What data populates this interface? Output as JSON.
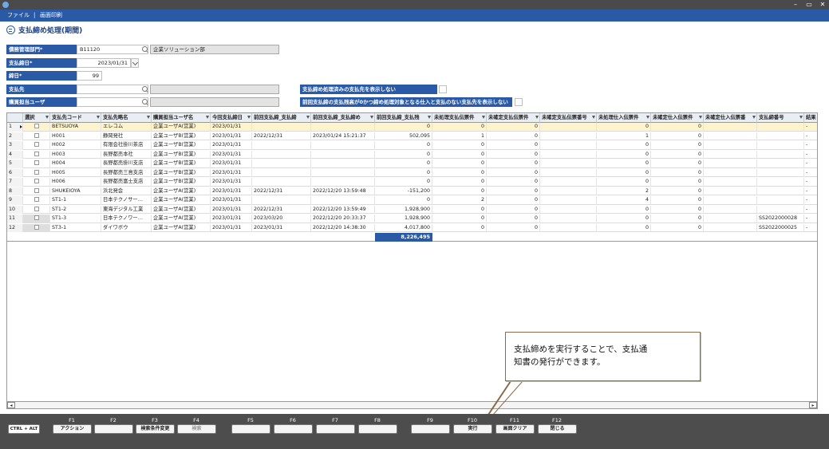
{
  "window": {
    "min": "–",
    "max": "▭",
    "close": "✕"
  },
  "menu": {
    "file": "ファイル",
    "sep": "|",
    "print": "画面印刷"
  },
  "page_title": "支払締め処理(期間)",
  "form": {
    "dept_label": "債務管理部門*",
    "dept_code": "B11120",
    "dept_name": "企業ソリューション部",
    "close_date_label": "支払締日*",
    "close_date": "2023/01/31",
    "close_day_label": "締日*",
    "close_day": "99",
    "payee_label": "支払先",
    "payee_value": "",
    "buyer_label": "購買担当ユーザ",
    "buyer_value": "",
    "opt1_label": "支払締め処理済みの支払先を表示しない",
    "opt2_label": "前回支払締の支払残高が0かつ締め処理対象となる仕入と支払のない支払先を表示しない"
  },
  "grid": {
    "headers": [
      "選択",
      "支払先コード",
      "支払先略名",
      "購買担当ユーザ名",
      "今回支払締日",
      "前回支払締_支払締",
      "前回支払締_支払締め",
      "前回支払締_支払残",
      "未処理支払伝票件",
      "未確定支払伝票件",
      "未確定支払伝票番号",
      "未処理仕入伝票件",
      "未確定仕入伝票件",
      "未確定仕入伝票番",
      "支払締番号",
      "結果"
    ],
    "rows": [
      {
        "n": "1",
        "code": "BETSUOYA",
        "name": "エレコム",
        "user": "企業ユーザA(営業)",
        "cur": "2023/01/31",
        "prev": "",
        "prevdt": "",
        "bal": "0",
        "up": "0",
        "uc": "0",
        "ucn": "",
        "upu": "0",
        "ucu": "0",
        "ucun": "",
        "no": "",
        "res": "-"
      },
      {
        "n": "2",
        "code": "H001",
        "name": "静岡発社",
        "user": "企業ユーザB(営業)",
        "cur": "2023/01/31",
        "prev": "2022/12/31",
        "prevdt": "2023/01/24 15:21:37",
        "bal": "502,095",
        "up": "1",
        "uc": "0",
        "ucn": "",
        "upu": "1",
        "ucu": "0",
        "ucun": "",
        "no": "",
        "res": "-"
      },
      {
        "n": "3",
        "code": "H002",
        "name": "有限会社掛川茶店",
        "user": "企業ユーザB(営業)",
        "cur": "2023/01/31",
        "prev": "",
        "prevdt": "",
        "bal": "0",
        "up": "0",
        "uc": "0",
        "ucn": "",
        "upu": "0",
        "ucu": "0",
        "ucun": "",
        "no": "",
        "res": "-"
      },
      {
        "n": "4",
        "code": "H003",
        "name": "長野都売本社",
        "user": "企業ユーザB(営業)",
        "cur": "2023/01/31",
        "prev": "",
        "prevdt": "",
        "bal": "0",
        "up": "0",
        "uc": "0",
        "ucn": "",
        "upu": "0",
        "ucu": "0",
        "ucun": "",
        "no": "",
        "res": "-"
      },
      {
        "n": "5",
        "code": "H004",
        "name": "長野都売掛川支店",
        "user": "企業ユーザB(営業)",
        "cur": "2023/01/31",
        "prev": "",
        "prevdt": "",
        "bal": "0",
        "up": "0",
        "uc": "0",
        "ucn": "",
        "upu": "0",
        "ucu": "0",
        "ucun": "",
        "no": "",
        "res": "-"
      },
      {
        "n": "6",
        "code": "H005",
        "name": "長野都売三島支店",
        "user": "企業ユーザB(営業)",
        "cur": "2023/01/31",
        "prev": "",
        "prevdt": "",
        "bal": "0",
        "up": "0",
        "uc": "0",
        "ucn": "",
        "upu": "0",
        "ucu": "0",
        "ucun": "",
        "no": "",
        "res": "-"
      },
      {
        "n": "7",
        "code": "H006",
        "name": "長野都売富士支店",
        "user": "企業ユーザB(営業)",
        "cur": "2023/01/31",
        "prev": "",
        "prevdt": "",
        "bal": "0",
        "up": "0",
        "uc": "0",
        "ucn": "",
        "upu": "0",
        "ucu": "0",
        "ucun": "",
        "no": "",
        "res": "-"
      },
      {
        "n": "8",
        "code": "SHUKEIOYA",
        "name": "浜北発会",
        "user": "企業ユーザA(営業)",
        "cur": "2023/01/31",
        "prev": "2022/12/31",
        "prevdt": "2022/12/20 13:59:48",
        "bal": "-151,200",
        "up": "0",
        "uc": "0",
        "ucn": "",
        "upu": "2",
        "ucu": "0",
        "ucun": "",
        "no": "",
        "res": "-"
      },
      {
        "n": "9",
        "code": "ST1-1",
        "name": "日本テクノサー…",
        "user": "企業ユーザA(営業)",
        "cur": "2023/01/31",
        "prev": "",
        "prevdt": "",
        "bal": "0",
        "up": "2",
        "uc": "0",
        "ucn": "",
        "upu": "4",
        "ucu": "0",
        "ucun": "",
        "no": "",
        "res": "-"
      },
      {
        "n": "10",
        "code": "ST1-2",
        "name": "東海デジタル工業",
        "user": "企業ユーザA(営業)",
        "cur": "2023/01/31",
        "prev": "2022/12/31",
        "prevdt": "2022/12/20 13:59:49",
        "bal": "1,928,900",
        "up": "0",
        "uc": "0",
        "ucn": "",
        "upu": "0",
        "ucu": "0",
        "ucun": "",
        "no": "",
        "res": "-"
      },
      {
        "n": "11",
        "code": "ST1-3",
        "name": "日本テクノワー…",
        "user": "企業ユーザA(営業)",
        "cur": "2023/01/31",
        "prev": "2023/03/20",
        "prevdt": "2022/12/20 20:33:37",
        "bal": "1,928,900",
        "up": "0",
        "uc": "0",
        "ucn": "",
        "upu": "0",
        "ucu": "0",
        "ucun": "",
        "no": "SS2022000028",
        "res": "-"
      },
      {
        "n": "12",
        "code": "ST3-1",
        "name": "ダイワボウ",
        "user": "企業ユーザA(営業)",
        "cur": "2023/01/31",
        "prev": "2023/01/31",
        "prevdt": "2022/12/20 14:38:30",
        "bal": "4,017,800",
        "up": "0",
        "uc": "0",
        "ucn": "",
        "upu": "0",
        "ucu": "0",
        "ucun": "",
        "no": "SS2022000025",
        "res": "-"
      }
    ],
    "total": "8,226,495"
  },
  "callout": {
    "line1": "支払締めを実行することで、支払通",
    "line2": "知書の発行ができます。"
  },
  "fkeys": {
    "ctrl_alt": "CTRL + ALT",
    "labels": [
      "F1",
      "F2",
      "F3",
      "F4",
      "F5",
      "F6",
      "F7",
      "F8",
      "F9",
      "F10",
      "F11",
      "F12"
    ],
    "buttons": [
      "アクション",
      "",
      "検索条件変更",
      "検索",
      "",
      "",
      "",
      "",
      "",
      "実行",
      "画面クリア",
      "閉じる"
    ]
  },
  "colors": {
    "accent": "#2a5aa6",
    "selected_row": "#fdf4cf"
  }
}
